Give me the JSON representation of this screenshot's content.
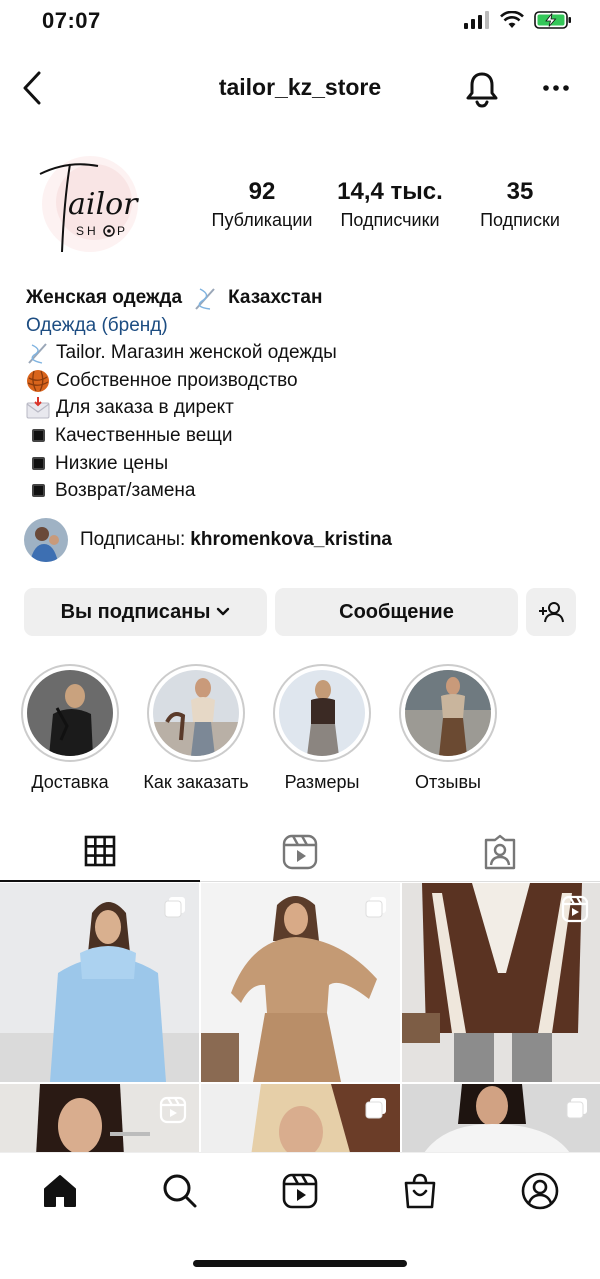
{
  "status": {
    "time": "07:07"
  },
  "header": {
    "username": "tailor_kz_store"
  },
  "profile": {
    "logo_text": "Tailor",
    "logo_subtext": "SHOP",
    "stats": [
      {
        "number": "92",
        "label": "Публикации"
      },
      {
        "number": "14,4 тыс.",
        "label": "Подписчики"
      },
      {
        "number": "35",
        "label": "Подписки"
      }
    ]
  },
  "bio": {
    "name": "Женская одежда",
    "name_suffix": "Казахстан",
    "category": "Одежда (бренд)",
    "lines": [
      "Tailor. Магазин женской одежды",
      "Собственное производство",
      "Для заказа в директ",
      "Качественные вещи",
      "Низкие цены",
      "Возврат/замена"
    ]
  },
  "followed_by": {
    "prefix": "Подписаны:",
    "name": "khromenkova_kristina"
  },
  "actions": {
    "following": "Вы подписаны",
    "message": "Сообщение"
  },
  "highlights": [
    {
      "label": "Доставка"
    },
    {
      "label": "Как заказать"
    },
    {
      "label": "Размеры"
    },
    {
      "label": "Отзывы"
    }
  ],
  "tabs": {
    "grid_icon": "grid-icon",
    "reels_icon": "reels-icon",
    "tagged_icon": "tagged-icon"
  },
  "colors": {
    "category_link": "#1d4d82",
    "button_bg": "#efefef",
    "battery": "#34c759"
  }
}
